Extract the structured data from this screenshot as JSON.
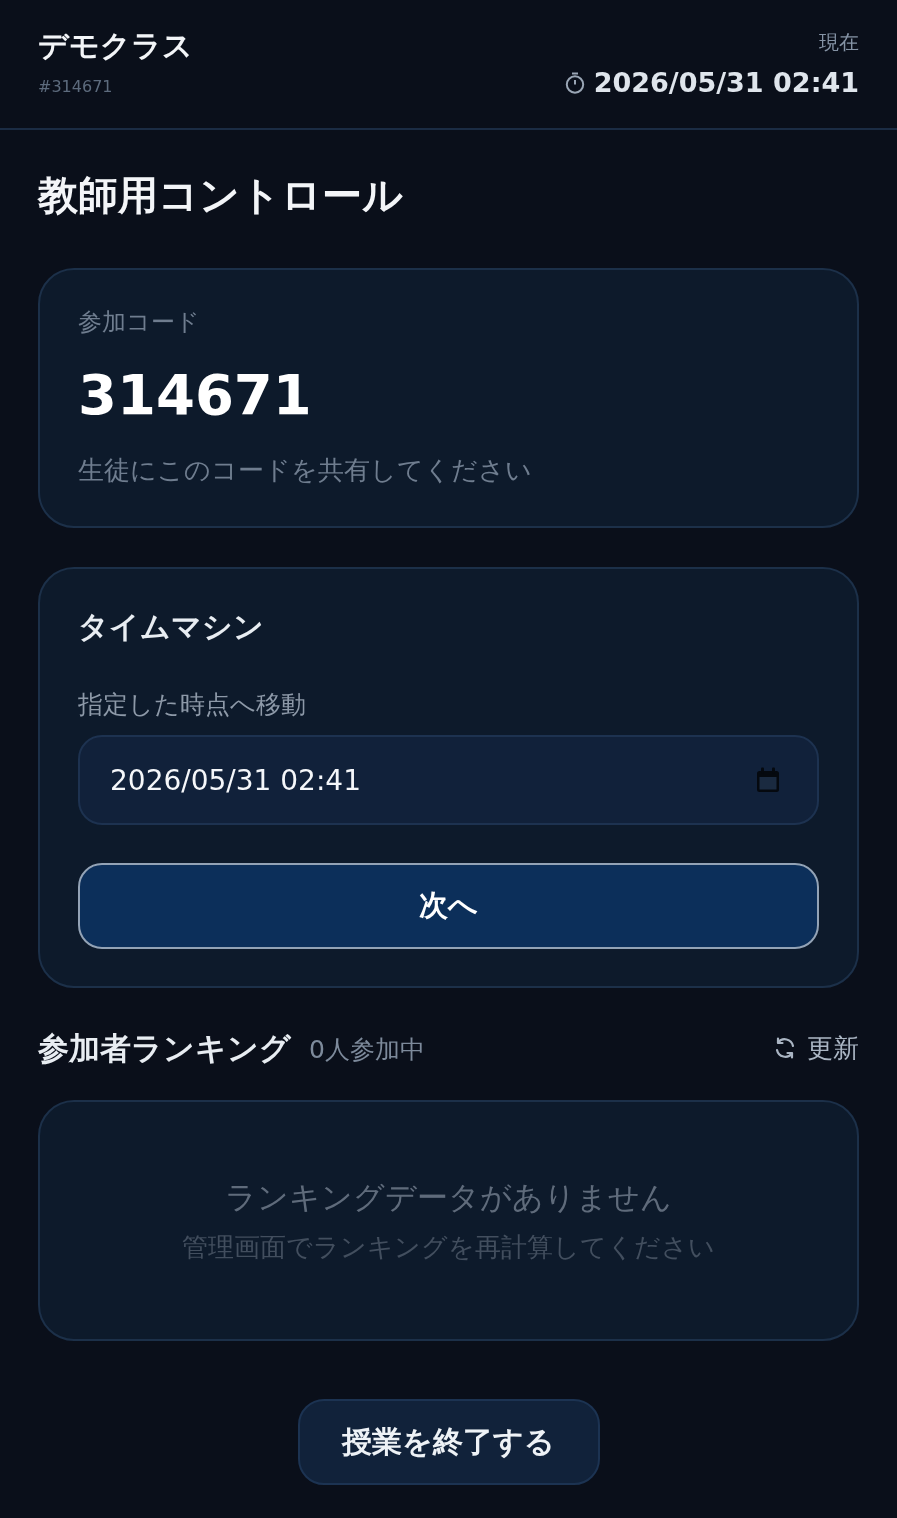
{
  "header": {
    "class_name": "デモクラス",
    "class_id": "#314671",
    "now_label": "現在",
    "now_time": "2026/05/31 02:41"
  },
  "page_title": "教師用コントロール",
  "join_code_card": {
    "label": "参加コード",
    "code": "314671",
    "hint": "生徒にこのコードを共有してください"
  },
  "time_machine_card": {
    "title": "タイムマシン",
    "field_label": "指定した時点へ移動",
    "datetime": {
      "value": "2026/05/31 02:41"
    },
    "next_button": "次へ"
  },
  "ranking": {
    "title": "参加者ランキング",
    "participant_count": "0人参加中",
    "refresh_button": "更新",
    "empty_title": "ランキングデータがありません",
    "empty_hint": "管理画面でランキングを再計算してください"
  },
  "end_button": "授業を終了する"
}
